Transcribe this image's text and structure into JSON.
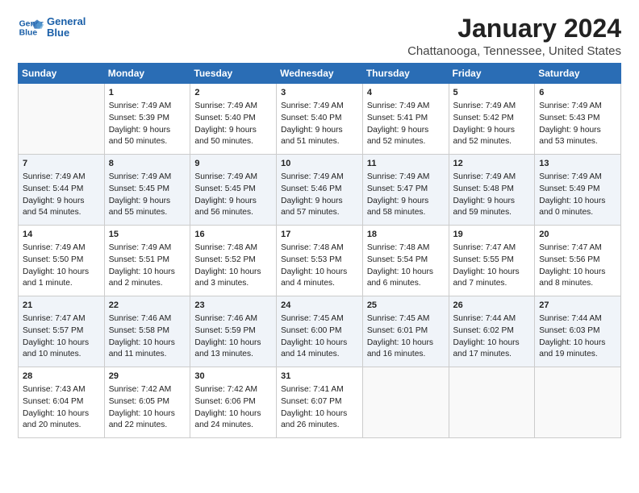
{
  "header": {
    "logo_line1": "General",
    "logo_line2": "Blue",
    "month_title": "January 2024",
    "location": "Chattanooga, Tennessee, United States"
  },
  "days_of_week": [
    "Sunday",
    "Monday",
    "Tuesday",
    "Wednesday",
    "Thursday",
    "Friday",
    "Saturday"
  ],
  "weeks": [
    [
      {
        "day": "",
        "sunrise": "",
        "sunset": "",
        "daylight": ""
      },
      {
        "day": "1",
        "sunrise": "Sunrise: 7:49 AM",
        "sunset": "Sunset: 5:39 PM",
        "daylight": "Daylight: 9 hours and 50 minutes."
      },
      {
        "day": "2",
        "sunrise": "Sunrise: 7:49 AM",
        "sunset": "Sunset: 5:40 PM",
        "daylight": "Daylight: 9 hours and 50 minutes."
      },
      {
        "day": "3",
        "sunrise": "Sunrise: 7:49 AM",
        "sunset": "Sunset: 5:40 PM",
        "daylight": "Daylight: 9 hours and 51 minutes."
      },
      {
        "day": "4",
        "sunrise": "Sunrise: 7:49 AM",
        "sunset": "Sunset: 5:41 PM",
        "daylight": "Daylight: 9 hours and 52 minutes."
      },
      {
        "day": "5",
        "sunrise": "Sunrise: 7:49 AM",
        "sunset": "Sunset: 5:42 PM",
        "daylight": "Daylight: 9 hours and 52 minutes."
      },
      {
        "day": "6",
        "sunrise": "Sunrise: 7:49 AM",
        "sunset": "Sunset: 5:43 PM",
        "daylight": "Daylight: 9 hours and 53 minutes."
      }
    ],
    [
      {
        "day": "7",
        "sunrise": "Sunrise: 7:49 AM",
        "sunset": "Sunset: 5:44 PM",
        "daylight": "Daylight: 9 hours and 54 minutes."
      },
      {
        "day": "8",
        "sunrise": "Sunrise: 7:49 AM",
        "sunset": "Sunset: 5:45 PM",
        "daylight": "Daylight: 9 hours and 55 minutes."
      },
      {
        "day": "9",
        "sunrise": "Sunrise: 7:49 AM",
        "sunset": "Sunset: 5:45 PM",
        "daylight": "Daylight: 9 hours and 56 minutes."
      },
      {
        "day": "10",
        "sunrise": "Sunrise: 7:49 AM",
        "sunset": "Sunset: 5:46 PM",
        "daylight": "Daylight: 9 hours and 57 minutes."
      },
      {
        "day": "11",
        "sunrise": "Sunrise: 7:49 AM",
        "sunset": "Sunset: 5:47 PM",
        "daylight": "Daylight: 9 hours and 58 minutes."
      },
      {
        "day": "12",
        "sunrise": "Sunrise: 7:49 AM",
        "sunset": "Sunset: 5:48 PM",
        "daylight": "Daylight: 9 hours and 59 minutes."
      },
      {
        "day": "13",
        "sunrise": "Sunrise: 7:49 AM",
        "sunset": "Sunset: 5:49 PM",
        "daylight": "Daylight: 10 hours and 0 minutes."
      }
    ],
    [
      {
        "day": "14",
        "sunrise": "Sunrise: 7:49 AM",
        "sunset": "Sunset: 5:50 PM",
        "daylight": "Daylight: 10 hours and 1 minute."
      },
      {
        "day": "15",
        "sunrise": "Sunrise: 7:49 AM",
        "sunset": "Sunset: 5:51 PM",
        "daylight": "Daylight: 10 hours and 2 minutes."
      },
      {
        "day": "16",
        "sunrise": "Sunrise: 7:48 AM",
        "sunset": "Sunset: 5:52 PM",
        "daylight": "Daylight: 10 hours and 3 minutes."
      },
      {
        "day": "17",
        "sunrise": "Sunrise: 7:48 AM",
        "sunset": "Sunset: 5:53 PM",
        "daylight": "Daylight: 10 hours and 4 minutes."
      },
      {
        "day": "18",
        "sunrise": "Sunrise: 7:48 AM",
        "sunset": "Sunset: 5:54 PM",
        "daylight": "Daylight: 10 hours and 6 minutes."
      },
      {
        "day": "19",
        "sunrise": "Sunrise: 7:47 AM",
        "sunset": "Sunset: 5:55 PM",
        "daylight": "Daylight: 10 hours and 7 minutes."
      },
      {
        "day": "20",
        "sunrise": "Sunrise: 7:47 AM",
        "sunset": "Sunset: 5:56 PM",
        "daylight": "Daylight: 10 hours and 8 minutes."
      }
    ],
    [
      {
        "day": "21",
        "sunrise": "Sunrise: 7:47 AM",
        "sunset": "Sunset: 5:57 PM",
        "daylight": "Daylight: 10 hours and 10 minutes."
      },
      {
        "day": "22",
        "sunrise": "Sunrise: 7:46 AM",
        "sunset": "Sunset: 5:58 PM",
        "daylight": "Daylight: 10 hours and 11 minutes."
      },
      {
        "day": "23",
        "sunrise": "Sunrise: 7:46 AM",
        "sunset": "Sunset: 5:59 PM",
        "daylight": "Daylight: 10 hours and 13 minutes."
      },
      {
        "day": "24",
        "sunrise": "Sunrise: 7:45 AM",
        "sunset": "Sunset: 6:00 PM",
        "daylight": "Daylight: 10 hours and 14 minutes."
      },
      {
        "day": "25",
        "sunrise": "Sunrise: 7:45 AM",
        "sunset": "Sunset: 6:01 PM",
        "daylight": "Daylight: 10 hours and 16 minutes."
      },
      {
        "day": "26",
        "sunrise": "Sunrise: 7:44 AM",
        "sunset": "Sunset: 6:02 PM",
        "daylight": "Daylight: 10 hours and 17 minutes."
      },
      {
        "day": "27",
        "sunrise": "Sunrise: 7:44 AM",
        "sunset": "Sunset: 6:03 PM",
        "daylight": "Daylight: 10 hours and 19 minutes."
      }
    ],
    [
      {
        "day": "28",
        "sunrise": "Sunrise: 7:43 AM",
        "sunset": "Sunset: 6:04 PM",
        "daylight": "Daylight: 10 hours and 20 minutes."
      },
      {
        "day": "29",
        "sunrise": "Sunrise: 7:42 AM",
        "sunset": "Sunset: 6:05 PM",
        "daylight": "Daylight: 10 hours and 22 minutes."
      },
      {
        "day": "30",
        "sunrise": "Sunrise: 7:42 AM",
        "sunset": "Sunset: 6:06 PM",
        "daylight": "Daylight: 10 hours and 24 minutes."
      },
      {
        "day": "31",
        "sunrise": "Sunrise: 7:41 AM",
        "sunset": "Sunset: 6:07 PM",
        "daylight": "Daylight: 10 hours and 26 minutes."
      },
      {
        "day": "",
        "sunrise": "",
        "sunset": "",
        "daylight": ""
      },
      {
        "day": "",
        "sunrise": "",
        "sunset": "",
        "daylight": ""
      },
      {
        "day": "",
        "sunrise": "",
        "sunset": "",
        "daylight": ""
      }
    ]
  ]
}
